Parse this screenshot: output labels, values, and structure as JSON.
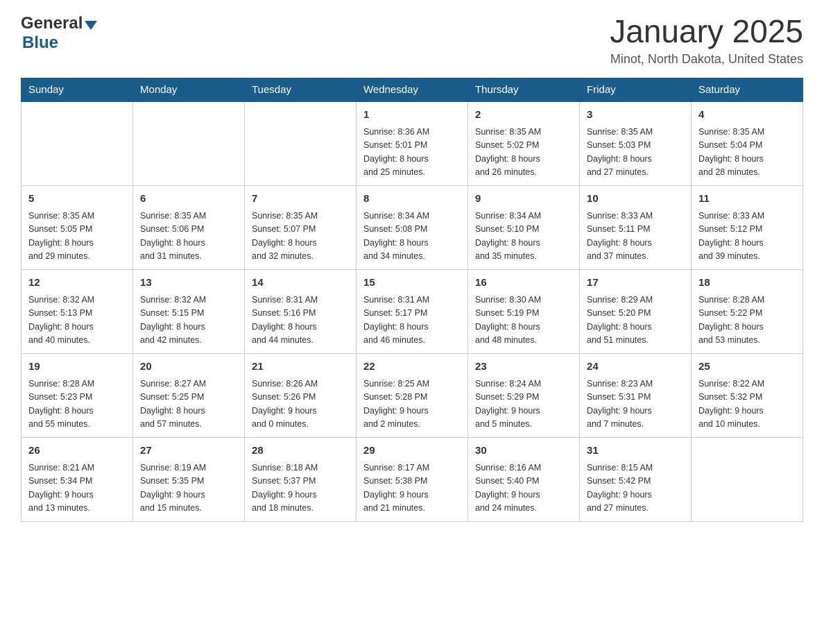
{
  "header": {
    "logo_general": "General",
    "logo_blue": "Blue",
    "month_title": "January 2025",
    "location": "Minot, North Dakota, United States"
  },
  "weekdays": [
    "Sunday",
    "Monday",
    "Tuesday",
    "Wednesday",
    "Thursday",
    "Friday",
    "Saturday"
  ],
  "weeks": [
    [
      {
        "day": "",
        "info": ""
      },
      {
        "day": "",
        "info": ""
      },
      {
        "day": "",
        "info": ""
      },
      {
        "day": "1",
        "info": "Sunrise: 8:36 AM\nSunset: 5:01 PM\nDaylight: 8 hours\nand 25 minutes."
      },
      {
        "day": "2",
        "info": "Sunrise: 8:35 AM\nSunset: 5:02 PM\nDaylight: 8 hours\nand 26 minutes."
      },
      {
        "day": "3",
        "info": "Sunrise: 8:35 AM\nSunset: 5:03 PM\nDaylight: 8 hours\nand 27 minutes."
      },
      {
        "day": "4",
        "info": "Sunrise: 8:35 AM\nSunset: 5:04 PM\nDaylight: 8 hours\nand 28 minutes."
      }
    ],
    [
      {
        "day": "5",
        "info": "Sunrise: 8:35 AM\nSunset: 5:05 PM\nDaylight: 8 hours\nand 29 minutes."
      },
      {
        "day": "6",
        "info": "Sunrise: 8:35 AM\nSunset: 5:06 PM\nDaylight: 8 hours\nand 31 minutes."
      },
      {
        "day": "7",
        "info": "Sunrise: 8:35 AM\nSunset: 5:07 PM\nDaylight: 8 hours\nand 32 minutes."
      },
      {
        "day": "8",
        "info": "Sunrise: 8:34 AM\nSunset: 5:08 PM\nDaylight: 8 hours\nand 34 minutes."
      },
      {
        "day": "9",
        "info": "Sunrise: 8:34 AM\nSunset: 5:10 PM\nDaylight: 8 hours\nand 35 minutes."
      },
      {
        "day": "10",
        "info": "Sunrise: 8:33 AM\nSunset: 5:11 PM\nDaylight: 8 hours\nand 37 minutes."
      },
      {
        "day": "11",
        "info": "Sunrise: 8:33 AM\nSunset: 5:12 PM\nDaylight: 8 hours\nand 39 minutes."
      }
    ],
    [
      {
        "day": "12",
        "info": "Sunrise: 8:32 AM\nSunset: 5:13 PM\nDaylight: 8 hours\nand 40 minutes."
      },
      {
        "day": "13",
        "info": "Sunrise: 8:32 AM\nSunset: 5:15 PM\nDaylight: 8 hours\nand 42 minutes."
      },
      {
        "day": "14",
        "info": "Sunrise: 8:31 AM\nSunset: 5:16 PM\nDaylight: 8 hours\nand 44 minutes."
      },
      {
        "day": "15",
        "info": "Sunrise: 8:31 AM\nSunset: 5:17 PM\nDaylight: 8 hours\nand 46 minutes."
      },
      {
        "day": "16",
        "info": "Sunrise: 8:30 AM\nSunset: 5:19 PM\nDaylight: 8 hours\nand 48 minutes."
      },
      {
        "day": "17",
        "info": "Sunrise: 8:29 AM\nSunset: 5:20 PM\nDaylight: 8 hours\nand 51 minutes."
      },
      {
        "day": "18",
        "info": "Sunrise: 8:28 AM\nSunset: 5:22 PM\nDaylight: 8 hours\nand 53 minutes."
      }
    ],
    [
      {
        "day": "19",
        "info": "Sunrise: 8:28 AM\nSunset: 5:23 PM\nDaylight: 8 hours\nand 55 minutes."
      },
      {
        "day": "20",
        "info": "Sunrise: 8:27 AM\nSunset: 5:25 PM\nDaylight: 8 hours\nand 57 minutes."
      },
      {
        "day": "21",
        "info": "Sunrise: 8:26 AM\nSunset: 5:26 PM\nDaylight: 9 hours\nand 0 minutes."
      },
      {
        "day": "22",
        "info": "Sunrise: 8:25 AM\nSunset: 5:28 PM\nDaylight: 9 hours\nand 2 minutes."
      },
      {
        "day": "23",
        "info": "Sunrise: 8:24 AM\nSunset: 5:29 PM\nDaylight: 9 hours\nand 5 minutes."
      },
      {
        "day": "24",
        "info": "Sunrise: 8:23 AM\nSunset: 5:31 PM\nDaylight: 9 hours\nand 7 minutes."
      },
      {
        "day": "25",
        "info": "Sunrise: 8:22 AM\nSunset: 5:32 PM\nDaylight: 9 hours\nand 10 minutes."
      }
    ],
    [
      {
        "day": "26",
        "info": "Sunrise: 8:21 AM\nSunset: 5:34 PM\nDaylight: 9 hours\nand 13 minutes."
      },
      {
        "day": "27",
        "info": "Sunrise: 8:19 AM\nSunset: 5:35 PM\nDaylight: 9 hours\nand 15 minutes."
      },
      {
        "day": "28",
        "info": "Sunrise: 8:18 AM\nSunset: 5:37 PM\nDaylight: 9 hours\nand 18 minutes."
      },
      {
        "day": "29",
        "info": "Sunrise: 8:17 AM\nSunset: 5:38 PM\nDaylight: 9 hours\nand 21 minutes."
      },
      {
        "day": "30",
        "info": "Sunrise: 8:16 AM\nSunset: 5:40 PM\nDaylight: 9 hours\nand 24 minutes."
      },
      {
        "day": "31",
        "info": "Sunrise: 8:15 AM\nSunset: 5:42 PM\nDaylight: 9 hours\nand 27 minutes."
      },
      {
        "day": "",
        "info": ""
      }
    ]
  ]
}
